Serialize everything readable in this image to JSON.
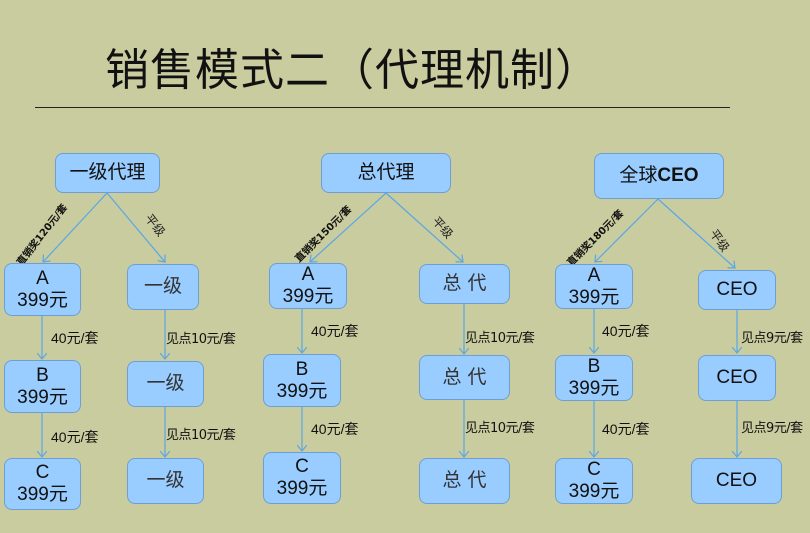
{
  "title": "销售模式二（代理机制）",
  "colors": {
    "background": "#c8cc9e",
    "box_fill": "#99ccff",
    "box_border": "#6d9fd6",
    "arrow": "#5aa6e6"
  },
  "diagrams": [
    {
      "root": "一级代理",
      "direct_label": "直销奖120元/套",
      "peer_label": "平级",
      "chain": [
        {
          "name": "A",
          "price": "399元"
        },
        {
          "name": "B",
          "price": "399元"
        },
        {
          "name": "C",
          "price": "399元"
        }
      ],
      "chain_edge_labels": [
        "40元/套",
        "40元/套"
      ],
      "peers": [
        "一级",
        "一级",
        "一级"
      ],
      "peer_edge_labels": [
        "见点10元/套",
        "见点10元/套"
      ]
    },
    {
      "root": "总代理",
      "direct_label": "直销奖150元/套",
      "peer_label": "平级",
      "chain": [
        {
          "name": "A",
          "price": "399元"
        },
        {
          "name": "B",
          "price": "399元"
        },
        {
          "name": "C",
          "price": "399元"
        }
      ],
      "chain_edge_labels": [
        "40元/套",
        "40元/套"
      ],
      "peers": [
        "总 代",
        "总 代",
        "总 代"
      ],
      "peer_edge_labels": [
        "见点10元/套",
        "见点10元/套"
      ]
    },
    {
      "root_cn": "全球",
      "root_en": "CEO",
      "direct_label": "直销奖180元/套",
      "peer_label": "平级",
      "chain": [
        {
          "name": "A",
          "price": "399元"
        },
        {
          "name": "B",
          "price": "399元"
        },
        {
          "name": "C",
          "price": "399元"
        }
      ],
      "chain_edge_labels": [
        "40元/套",
        "40元/套"
      ],
      "peers": [
        "CEO",
        "CEO",
        "CEO"
      ],
      "peer_edge_labels": [
        "见点9元/套",
        "见点9元/套"
      ]
    }
  ]
}
